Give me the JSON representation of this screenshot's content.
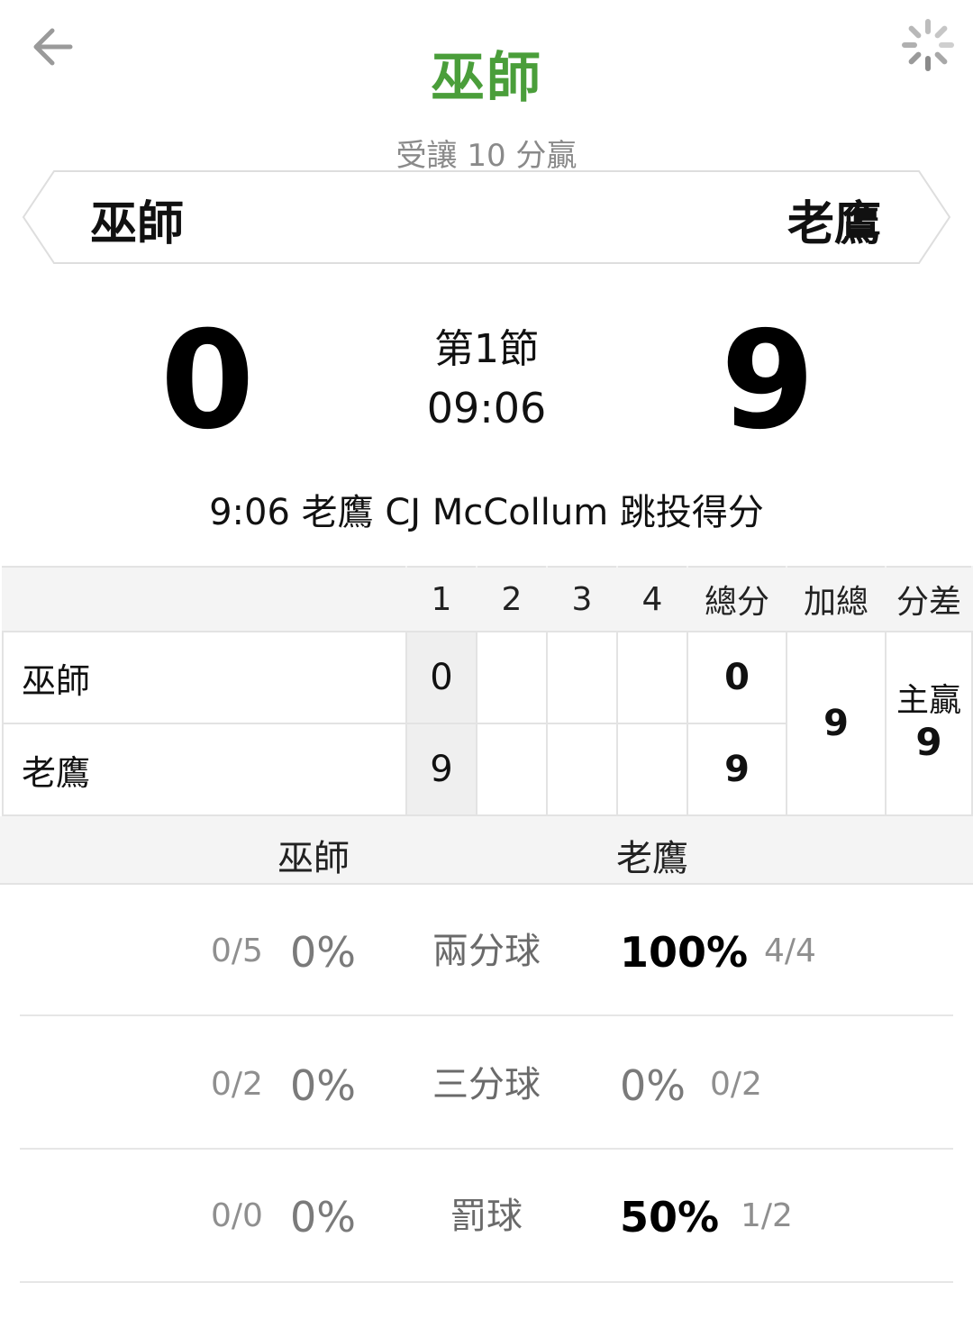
{
  "header": {
    "pick_team": "巫師",
    "pick_note": "受讓 10 分贏",
    "back_icon": "back-arrow-icon",
    "loading_icon": "loading-spinner-icon",
    "accent_color": "#4a9e3a"
  },
  "matchup": {
    "away_team": "巫師",
    "home_team": "老鷹"
  },
  "scoreboard": {
    "away_score": "0",
    "home_score": "9",
    "period": "第1節",
    "clock": "09:06",
    "last_play": "9:06 老鷹 CJ McCollum 跳投得分"
  },
  "box_score": {
    "headers": [
      "",
      "1",
      "2",
      "3",
      "4",
      "總分",
      "加總",
      "分差"
    ],
    "rows": [
      {
        "team": "巫師",
        "q1": "0",
        "q2": "",
        "q3": "",
        "q4": "",
        "total": "0"
      },
      {
        "team": "老鷹",
        "q1": "9",
        "q2": "",
        "q3": "",
        "q4": "",
        "total": "9"
      }
    ],
    "combined": "9",
    "diff_label": "主贏",
    "diff_value": "9"
  },
  "stats": {
    "away_team": "巫師",
    "home_team": "老鷹",
    "rows": [
      {
        "label": "兩分球",
        "away_frac": "0/5",
        "away_pct": "0%",
        "home_pct": "100%",
        "home_frac": "4/4"
      },
      {
        "label": "三分球",
        "away_frac": "0/2",
        "away_pct": "0%",
        "home_pct": "0%",
        "home_frac": "0/2"
      },
      {
        "label": "罰球",
        "away_frac": "0/0",
        "away_pct": "0%",
        "home_pct": "50%",
        "home_frac": "1/2"
      }
    ]
  }
}
